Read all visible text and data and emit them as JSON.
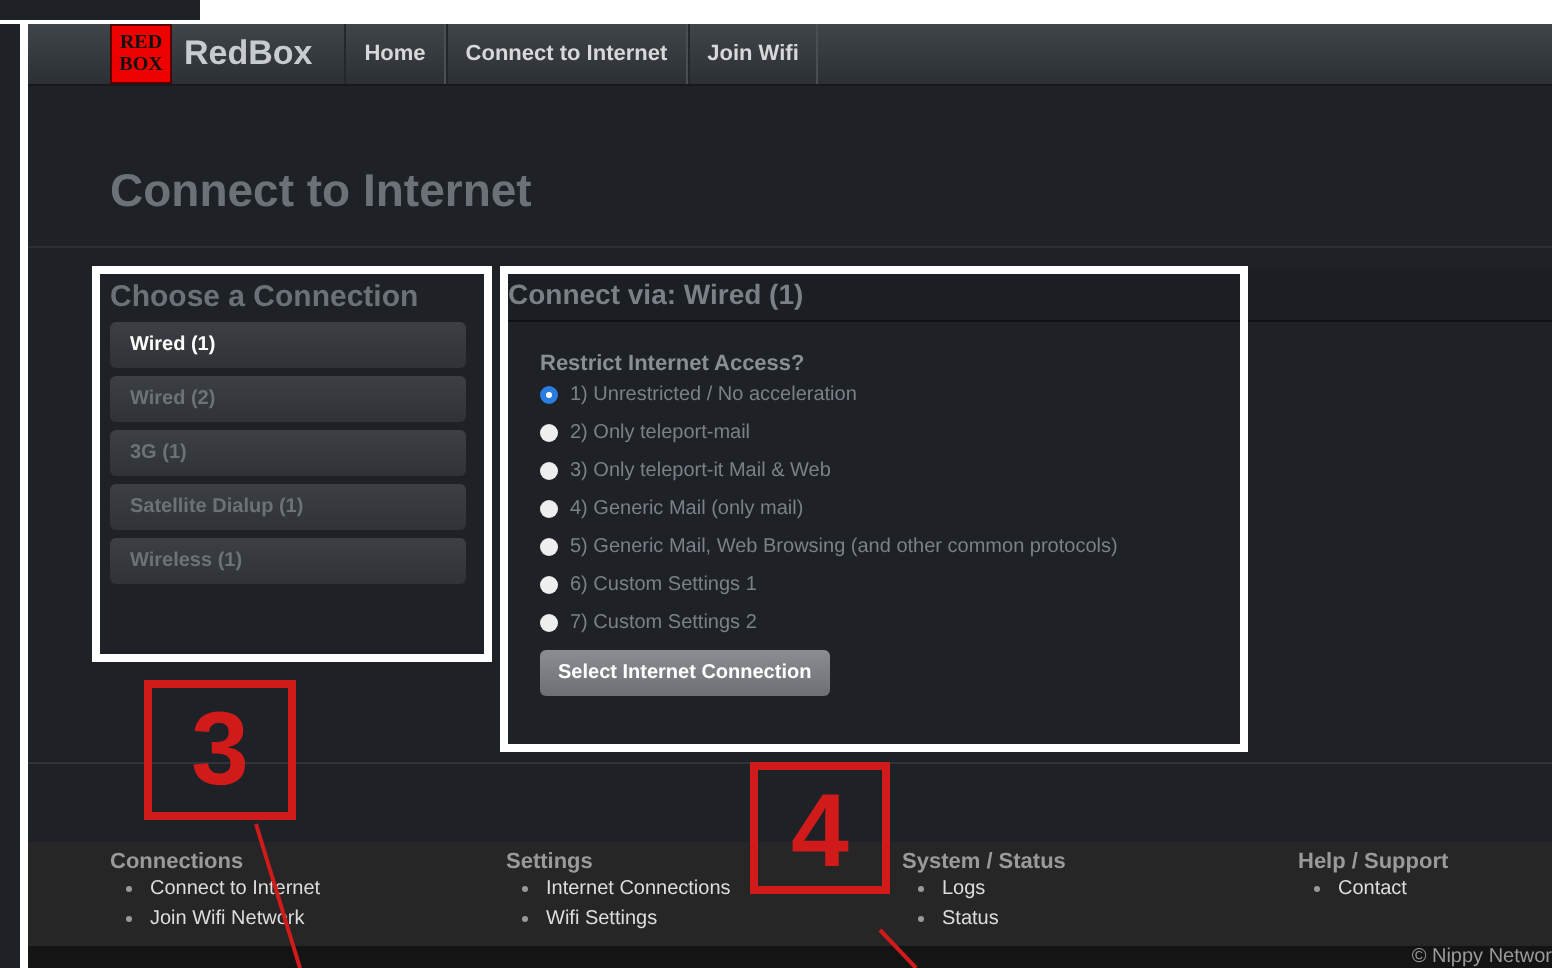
{
  "brand": {
    "logo_lines": [
      "RED",
      "BOX"
    ],
    "name": "RedBox"
  },
  "nav": [
    {
      "label": "Home"
    },
    {
      "label": "Connect to Internet"
    },
    {
      "label": "Join Wifi"
    }
  ],
  "page_title": "Connect to Internet",
  "sidebar": {
    "heading": "Choose a Connection",
    "items": [
      {
        "label": "Wired (1)",
        "selected": true
      },
      {
        "label": "Wired (2)",
        "selected": false
      },
      {
        "label": "3G (1)",
        "selected": false
      },
      {
        "label": "Satellite Dialup (1)",
        "selected": false
      },
      {
        "label": "Wireless (1)",
        "selected": false
      }
    ]
  },
  "panel": {
    "heading": "Connect via: Wired (1)",
    "question": "Restrict Internet Access?",
    "options": [
      {
        "label": "1) Unrestricted / No acceleration",
        "selected": true
      },
      {
        "label": "2) Only teleport-mail",
        "selected": false
      },
      {
        "label": "3) Only teleport-it Mail & Web",
        "selected": false
      },
      {
        "label": "4) Generic Mail (only mail)",
        "selected": false
      },
      {
        "label": "5) Generic Mail, Web Browsing (and other common protocols)",
        "selected": false
      },
      {
        "label": "6) Custom Settings 1",
        "selected": false
      },
      {
        "label": "7) Custom Settings 2",
        "selected": false
      }
    ],
    "button": "Select Internet Connection"
  },
  "footer": {
    "columns": [
      {
        "heading": "Connections",
        "links": [
          "Connect to Internet",
          "Join Wifi Network"
        ]
      },
      {
        "heading": "Settings",
        "links": [
          "Internet Connections",
          "Wifi Settings"
        ]
      },
      {
        "heading": "System / Status",
        "links": [
          "Logs",
          "Status"
        ]
      },
      {
        "heading": "Help / Support",
        "links": [
          "Contact"
        ]
      }
    ],
    "copyright": "© Nippy Networ"
  },
  "annotations": [
    {
      "label": "3"
    },
    {
      "label": "4"
    }
  ]
}
